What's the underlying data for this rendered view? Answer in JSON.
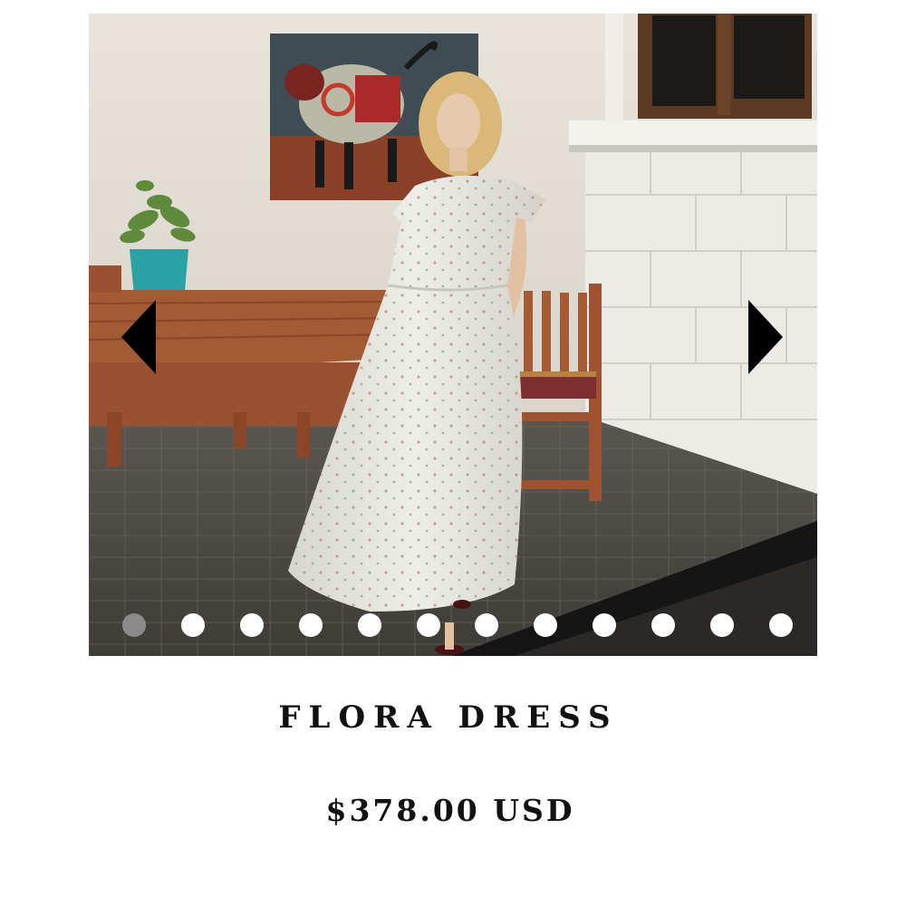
{
  "carousel": {
    "slide_count": 12,
    "active_index": 0,
    "image_alt": "Model wearing the Flora Dress on a patio beside a wooden table and bench",
    "prev_icon": "caret-left-icon",
    "next_icon": "caret-right-icon"
  },
  "product": {
    "title": "FLORA DRESS",
    "price": "$378.00 USD"
  }
}
